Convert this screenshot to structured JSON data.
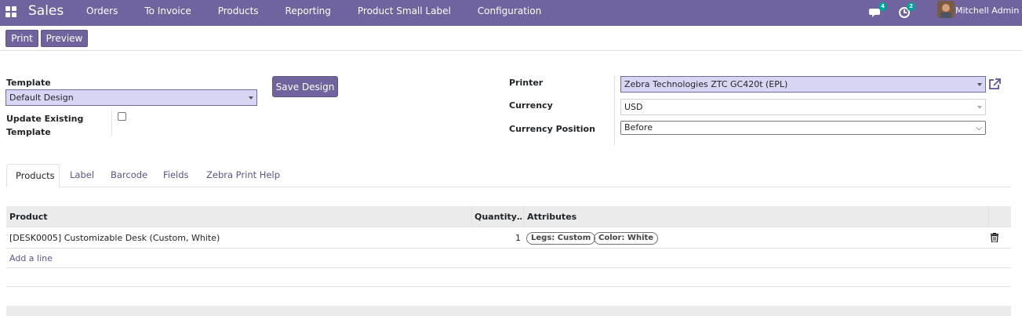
{
  "navbar": {
    "brand": "Sales",
    "menu": [
      "Orders",
      "To Invoice",
      "Products",
      "Reporting",
      "Product Small Label",
      "Configuration"
    ],
    "messages_count": "4",
    "activities_count": "2",
    "user_name": "Mitchell Admin",
    "icons": {
      "apps": "apps-grid-icon",
      "messages": "chat-icon",
      "activities": "clock-icon"
    }
  },
  "control_panel": {
    "print_label": "Print",
    "preview_label": "Preview"
  },
  "form": {
    "template_label": "Template",
    "template_value": "Default Design",
    "save_design_label": "Save Design",
    "update_existing_label_1": "Update Existing",
    "update_existing_label_2": "Template",
    "update_existing_checked": false,
    "printer_label": "Printer",
    "printer_value": "Zebra Technologies ZTC GC420t (EPL)",
    "currency_label": "Currency",
    "currency_value": "USD",
    "currency_position_label": "Currency Position",
    "currency_position_value": "Before"
  },
  "tabs": [
    "Products",
    "Label",
    "Barcode",
    "Fields",
    "Zebra Print Help"
  ],
  "active_tab": "Products",
  "table": {
    "headers": [
      "Product",
      "Quantity…",
      "Attributes"
    ],
    "rows": [
      {
        "product": "[DESK0005] Customizable Desk (Custom, White)",
        "quantity": "1",
        "attributes": [
          "Legs: Custom",
          "Color: White"
        ]
      }
    ],
    "add_line_label": "Add a line"
  },
  "colors": {
    "brand": "#71639e",
    "badge": "#00a09d",
    "link": "#5f5387"
  }
}
